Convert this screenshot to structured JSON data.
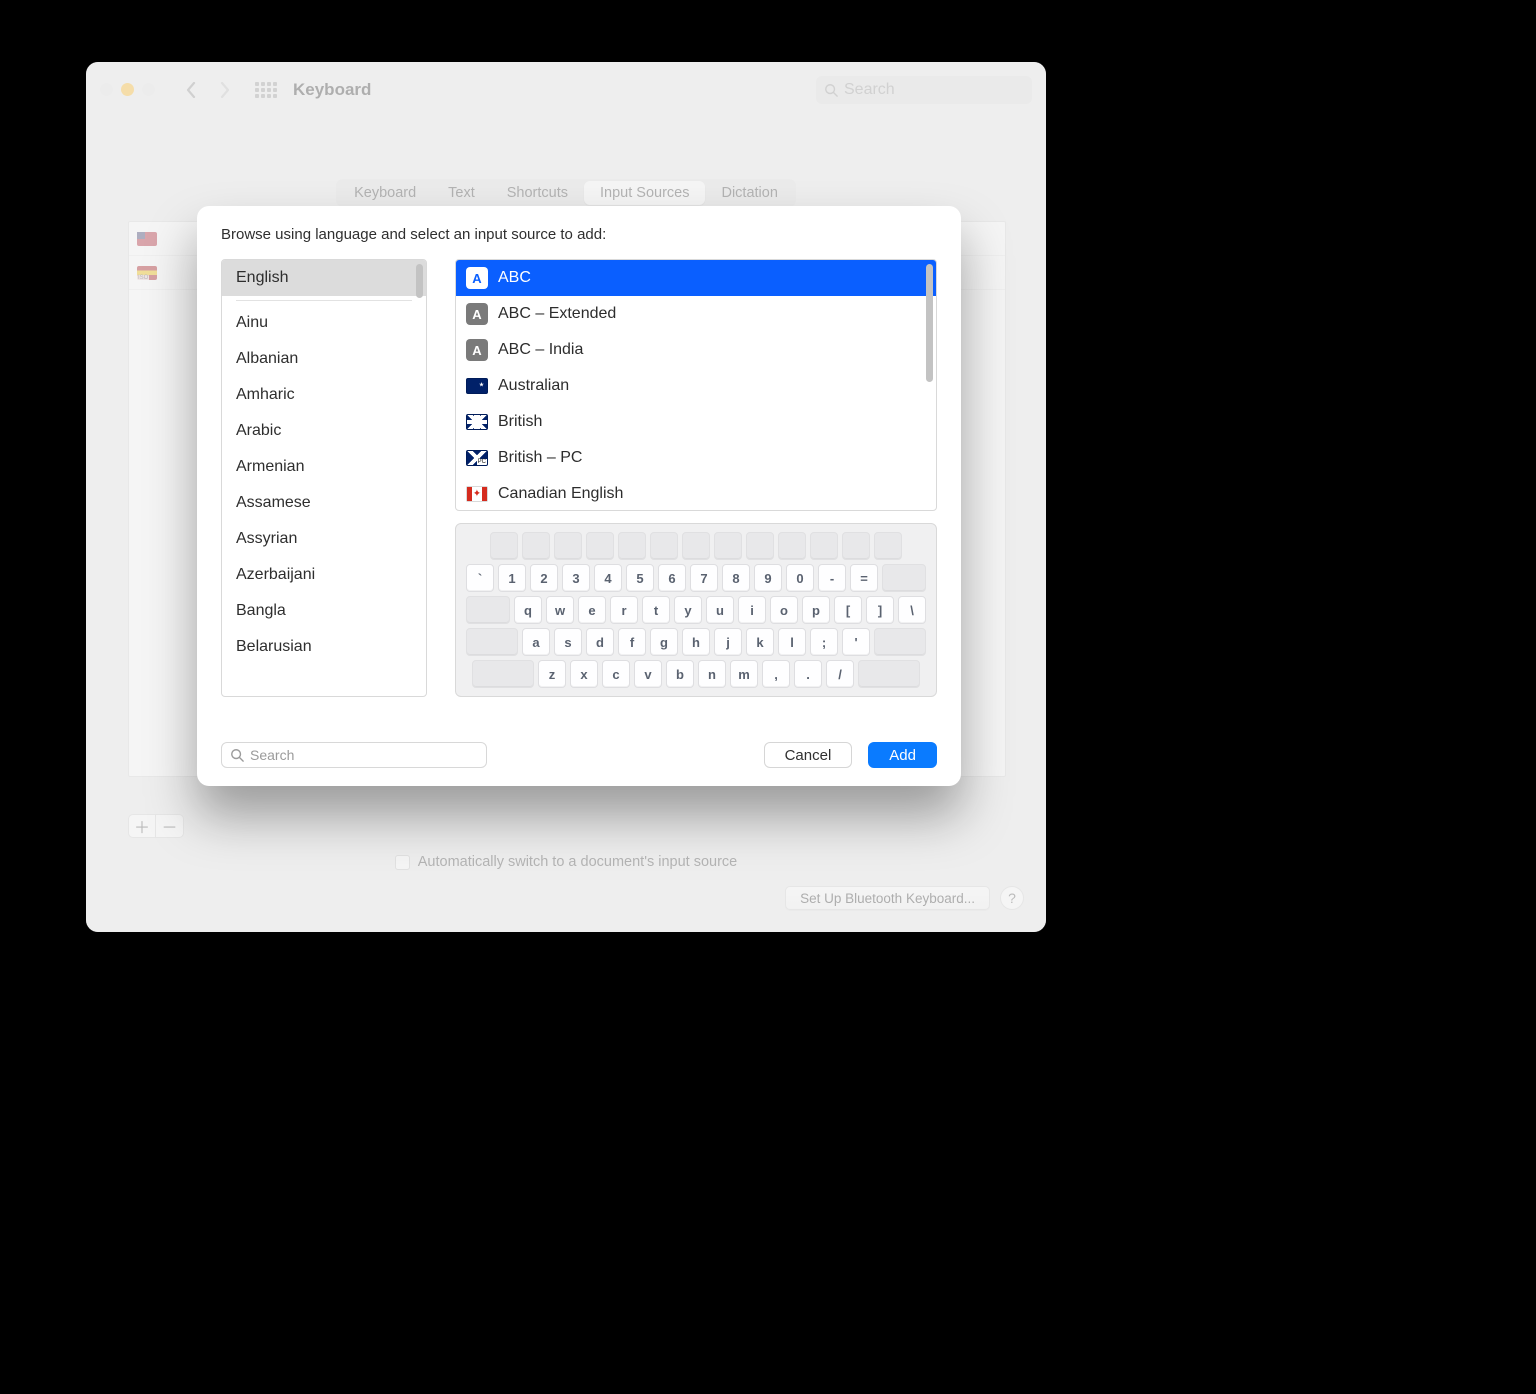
{
  "window": {
    "title": "Keyboard",
    "search_placeholder": "Search"
  },
  "tabs": {
    "items": [
      "Keyboard",
      "Text",
      "Shortcuts",
      "Input Sources",
      "Dictation"
    ],
    "selected_index": 3
  },
  "background_sources": {
    "items": [
      {
        "name": "",
        "flag": "us"
      },
      {
        "name": "",
        "flag": "es-iso"
      }
    ]
  },
  "auto_switch": {
    "label": "Automatically switch to a document's input source",
    "checked": false
  },
  "buttons": {
    "setup_bluetooth": "Set Up Bluetooth Keyboard...",
    "help": "?"
  },
  "sheet": {
    "title": "Browse using language and select an input source to add:",
    "languages": [
      {
        "name": "English",
        "selected": true,
        "divider_after": true
      },
      {
        "name": "Ainu"
      },
      {
        "name": "Albanian"
      },
      {
        "name": "Amharic"
      },
      {
        "name": "Arabic"
      },
      {
        "name": "Armenian"
      },
      {
        "name": "Assamese"
      },
      {
        "name": "Assyrian"
      },
      {
        "name": "Azerbaijani"
      },
      {
        "name": "Bangla"
      },
      {
        "name": "Belarusian"
      }
    ],
    "sources": [
      {
        "name": "ABC",
        "icon": "A",
        "selected": true
      },
      {
        "name": "ABC – Extended",
        "icon": "A"
      },
      {
        "name": "ABC – India",
        "icon": "A"
      },
      {
        "name": "Australian",
        "flag": "au"
      },
      {
        "name": "British",
        "flag": "gb"
      },
      {
        "name": "British – PC",
        "flag": "gbpc"
      },
      {
        "name": "Canadian English",
        "flag": "ca"
      }
    ],
    "keyboard_preview": {
      "row1_blank_count": 13,
      "row2": [
        "`",
        "1",
        "2",
        "3",
        "4",
        "5",
        "6",
        "7",
        "8",
        "9",
        "0",
        "-",
        "="
      ],
      "row3": [
        "q",
        "w",
        "e",
        "r",
        "t",
        "y",
        "u",
        "i",
        "o",
        "p",
        "[",
        "]",
        "\\"
      ],
      "row4": [
        "a",
        "s",
        "d",
        "f",
        "g",
        "h",
        "j",
        "k",
        "l",
        ";",
        "'"
      ],
      "row5": [
        "z",
        "x",
        "c",
        "v",
        "b",
        "n",
        "m",
        ",",
        ".",
        "/"
      ]
    },
    "search_placeholder": "Search",
    "cancel_label": "Cancel",
    "add_label": "Add"
  }
}
